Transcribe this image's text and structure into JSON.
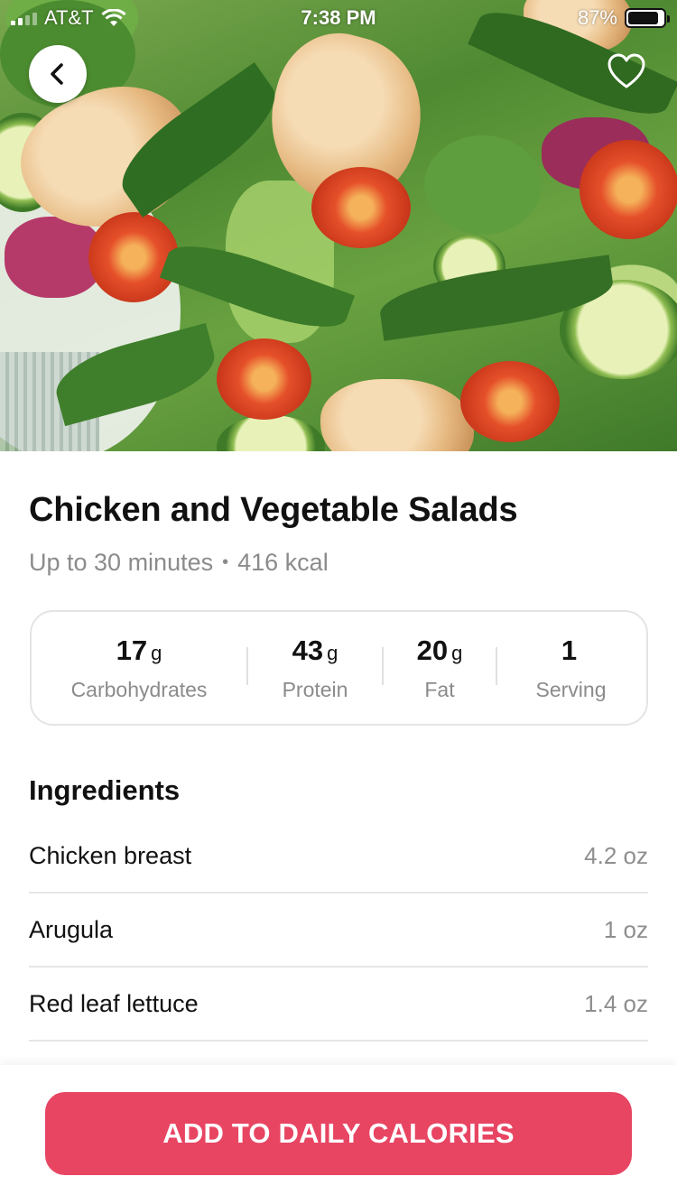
{
  "status_bar": {
    "carrier": "AT&T",
    "time": "7:38 PM",
    "battery_percent": "87%",
    "battery_level": 0.87,
    "signal_bars": 2,
    "signal_total": 4
  },
  "hero": {
    "back_icon": "chevron-left-icon",
    "favorite_icon": "heart-outline-icon"
  },
  "recipe": {
    "title": "Chicken and Vegetable Salads",
    "duration": "Up to 30 minutes",
    "separator": "•",
    "calories": "416 kcal"
  },
  "macros": [
    {
      "value": "17",
      "unit": "g",
      "label": "Carbohydrates"
    },
    {
      "value": "43",
      "unit": "g",
      "label": "Protein"
    },
    {
      "value": "20",
      "unit": "g",
      "label": "Fat"
    },
    {
      "value": "1",
      "unit": "",
      "label": "Serving"
    }
  ],
  "ingredients": {
    "heading": "Ingredients",
    "items": [
      {
        "name": "Chicken breast",
        "amount": "4.2 oz"
      },
      {
        "name": "Arugula",
        "amount": "1 oz"
      },
      {
        "name": "Red leaf lettuce",
        "amount": "1.4 oz"
      }
    ]
  },
  "footer": {
    "cta_label": "ADD TO DAILY CALORIES"
  },
  "colors": {
    "accent": "#e84563",
    "text_primary": "#111111",
    "text_secondary": "#8b8b8b"
  }
}
